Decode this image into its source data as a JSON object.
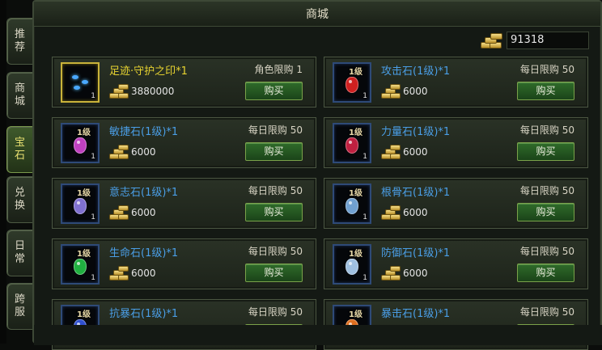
{
  "window": {
    "title": "商城"
  },
  "side_tabs": [
    {
      "label": "推荐",
      "active": false
    },
    {
      "label": "商城",
      "active": false
    },
    {
      "label": "宝石",
      "active": true
    },
    {
      "label": "兑换",
      "active": false
    },
    {
      "label": "日常",
      "active": false
    },
    {
      "label": "跨服",
      "active": false
    }
  ],
  "currency": {
    "icon": "gold-ingot-icon",
    "value": "91318"
  },
  "buy_label": "购买",
  "items": [
    {
      "name": "足迹·守护之印*1",
      "limit": "角色限购 1",
      "price": "3880000",
      "qty": "1",
      "badge": "",
      "rare": true,
      "gem_color": ""
    },
    {
      "name": "攻击石(1级)*1",
      "limit": "每日限购 50",
      "price": "6000",
      "qty": "1",
      "badge": "1级",
      "rare": false,
      "gem_color": "#d02020"
    },
    {
      "name": "敏捷石(1级)*1",
      "limit": "每日限购 50",
      "price": "6000",
      "qty": "1",
      "badge": "1级",
      "rare": false,
      "gem_color": "#c040c0"
    },
    {
      "name": "力量石(1级)*1",
      "limit": "每日限购 50",
      "price": "6000",
      "qty": "1",
      "badge": "1级",
      "rare": false,
      "gem_color": "#c02040"
    },
    {
      "name": "意志石(1级)*1",
      "limit": "每日限购 50",
      "price": "6000",
      "qty": "1",
      "badge": "1级",
      "rare": false,
      "gem_color": "#8070d0"
    },
    {
      "name": "根骨石(1级)*1",
      "limit": "每日限购 50",
      "price": "6000",
      "qty": "1",
      "badge": "1级",
      "rare": false,
      "gem_color": "#70a0d0"
    },
    {
      "name": "生命石(1级)*1",
      "limit": "每日限购 50",
      "price": "6000",
      "qty": "1",
      "badge": "1级",
      "rare": false,
      "gem_color": "#20b040"
    },
    {
      "name": "防御石(1级)*1",
      "limit": "每日限购 50",
      "price": "6000",
      "qty": "1",
      "badge": "1级",
      "rare": false,
      "gem_color": "#a0c0e0"
    },
    {
      "name": "抗暴石(1级)*1",
      "limit": "每日限购 50",
      "price": "",
      "qty": "1",
      "badge": "1级",
      "rare": false,
      "gem_color": "#3050d0"
    },
    {
      "name": "暴击石(1级)*1",
      "limit": "每日限购 50",
      "price": "",
      "qty": "1",
      "badge": "1级",
      "rare": false,
      "gem_color": "#e07020"
    }
  ]
}
